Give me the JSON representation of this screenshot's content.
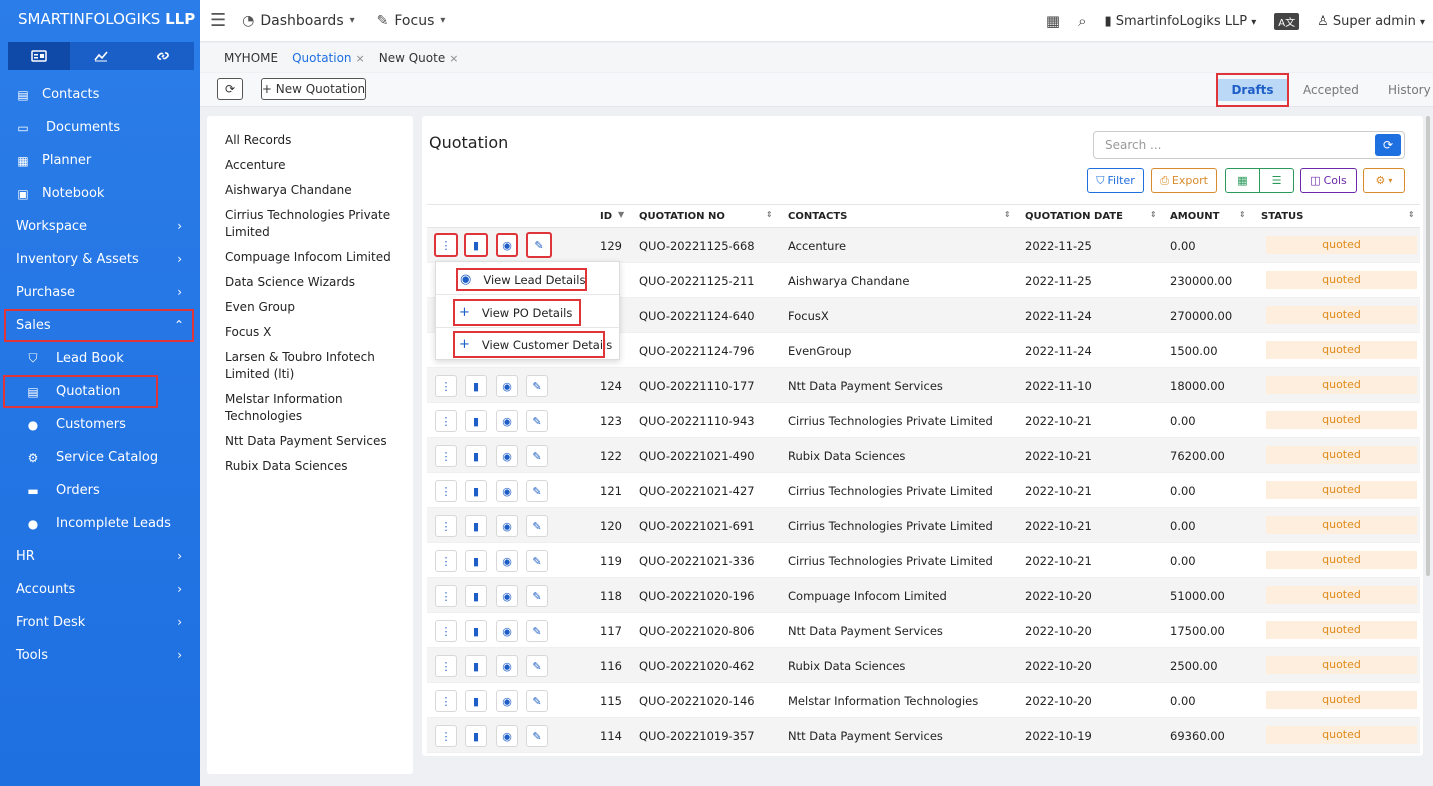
{
  "brand": {
    "name": "SMARTINFOLOGIKS",
    "suffix": "LLP"
  },
  "sidebar": {
    "tabs": [
      {
        "icon": "id-card-icon"
      },
      {
        "icon": "chart-line-icon"
      },
      {
        "icon": "link-icon"
      }
    ],
    "items": [
      {
        "label": "Contacts",
        "icon": "contact-book-icon"
      },
      {
        "label": "Documents",
        "icon": "folder-open-icon"
      },
      {
        "label": "Planner",
        "icon": "calendar-icon"
      },
      {
        "label": "Notebook",
        "icon": "notebook-icon"
      },
      {
        "label": "Workspace",
        "icon": "chevron-right-icon"
      },
      {
        "label": "Inventory & Assets",
        "icon": "chevron-right-icon"
      },
      {
        "label": "Purchase",
        "icon": "chevron-right-icon"
      },
      {
        "label": "Sales",
        "icon": "chevron-up-icon"
      }
    ],
    "sales_sub": [
      {
        "label": "Lead Book",
        "icon": "funnel-icon"
      },
      {
        "label": "Quotation",
        "icon": "document-icon"
      },
      {
        "label": "Customers",
        "icon": "user-icon"
      },
      {
        "label": "Service Catalog",
        "icon": "gears-icon"
      },
      {
        "label": "Orders",
        "icon": "truck-icon"
      },
      {
        "label": "Incomplete Leads",
        "icon": "user-icon"
      }
    ],
    "bottom": [
      {
        "label": "HR"
      },
      {
        "label": "Accounts"
      },
      {
        "label": "Front Desk"
      },
      {
        "label": "Tools"
      }
    ]
  },
  "topbar": {
    "dashboards": "Dashboards",
    "focus": "Focus",
    "company": "SmartinfoLogiks LLP",
    "user": "Super admin"
  },
  "breadcrumbs": {
    "home": "MYHOME",
    "tab1": "Quotation",
    "tab2": "New Quote",
    "close": "×"
  },
  "toolbar": {
    "refresh": "⟳",
    "new_quotation": "+ New Quotation",
    "seg_drafts": "Drafts",
    "seg_accepted": "Accepted",
    "seg_history": "History"
  },
  "left_panel": [
    "All Records",
    "Accenture",
    "Aishwarya Chandane",
    "Cirrius Technologies Private Limited",
    "Compuage Infocom Limited",
    "Data Science Wizards",
    "Even Group",
    "Focus X",
    "Larsen & Toubro Infotech Limited (lti)",
    "Melstar Information Technologies",
    "Ntt Data Payment Services",
    "Rubix Data Sciences"
  ],
  "main": {
    "title": "Quotation",
    "search_placeholder": "Search ...",
    "filter": "Filter",
    "export": "Export",
    "cols": "Cols"
  },
  "table": {
    "headers": [
      "ID",
      "QUOTATION NO",
      "CONTACTS",
      "QUOTATION DATE",
      "AMOUNT",
      "STATUS"
    ],
    "rows": [
      {
        "id": "129",
        "no": "QUO-20221125-668",
        "contact": "Accenture",
        "date": "2022-11-25",
        "amount": "0.00",
        "status": "quoted"
      },
      {
        "id": "",
        "no": "QUO-20221125-211",
        "contact": "Aishwarya Chandane",
        "date": "2022-11-25",
        "amount": "230000.00",
        "status": "quoted"
      },
      {
        "id": "",
        "no": "QUO-20221124-640",
        "contact": "FocusX",
        "date": "2022-11-24",
        "amount": "270000.00",
        "status": "quoted"
      },
      {
        "id": "",
        "no": "QUO-20221124-796",
        "contact": "EvenGroup",
        "date": "2022-11-24",
        "amount": "1500.00",
        "status": "quoted"
      },
      {
        "id": "124",
        "no": "QUO-20221110-177",
        "contact": "Ntt Data Payment Services",
        "date": "2022-11-10",
        "amount": "18000.00",
        "status": "quoted"
      },
      {
        "id": "123",
        "no": "QUO-20221110-943",
        "contact": "Cirrius Technologies Private Limited",
        "date": "2022-10-21",
        "amount": "0.00",
        "status": "quoted"
      },
      {
        "id": "122",
        "no": "QUO-20221021-490",
        "contact": "Rubix Data Sciences",
        "date": "2022-10-21",
        "amount": "76200.00",
        "status": "quoted"
      },
      {
        "id": "121",
        "no": "QUO-20221021-427",
        "contact": "Cirrius Technologies Private Limited",
        "date": "2022-10-21",
        "amount": "0.00",
        "status": "quoted"
      },
      {
        "id": "120",
        "no": "QUO-20221021-691",
        "contact": "Cirrius Technologies Private Limited",
        "date": "2022-10-21",
        "amount": "0.00",
        "status": "quoted"
      },
      {
        "id": "119",
        "no": "QUO-20221021-336",
        "contact": "Cirrius Technologies Private Limited",
        "date": "2022-10-21",
        "amount": "0.00",
        "status": "quoted"
      },
      {
        "id": "118",
        "no": "QUO-20221020-196",
        "contact": "Compuage Infocom Limited",
        "date": "2022-10-20",
        "amount": "51000.00",
        "status": "quoted"
      },
      {
        "id": "117",
        "no": "QUO-20221020-806",
        "contact": "Ntt Data Payment Services",
        "date": "2022-10-20",
        "amount": "17500.00",
        "status": "quoted"
      },
      {
        "id": "116",
        "no": "QUO-20221020-462",
        "contact": "Rubix Data Sciences",
        "date": "2022-10-20",
        "amount": "2500.00",
        "status": "quoted"
      },
      {
        "id": "115",
        "no": "QUO-20221020-146",
        "contact": "Melstar Information Technologies",
        "date": "2022-10-20",
        "amount": "0.00",
        "status": "quoted"
      },
      {
        "id": "114",
        "no": "QUO-20221019-357",
        "contact": "Ntt Data Payment Services",
        "date": "2022-10-19",
        "amount": "69360.00",
        "status": "quoted"
      }
    ]
  },
  "dropdown": [
    {
      "label": "View Lead Details",
      "icon": "eye-icon"
    },
    {
      "label": "View PO Details",
      "icon": "plus-icon"
    },
    {
      "label": "View Customer Details",
      "icon": "plus-icon"
    }
  ],
  "colors": {
    "sidebar": "#2b7de9",
    "accent": "#1e6fe0",
    "highlight": "#e0343b",
    "badge_bg": "#fdeede",
    "badge_text": "#e08a18"
  }
}
